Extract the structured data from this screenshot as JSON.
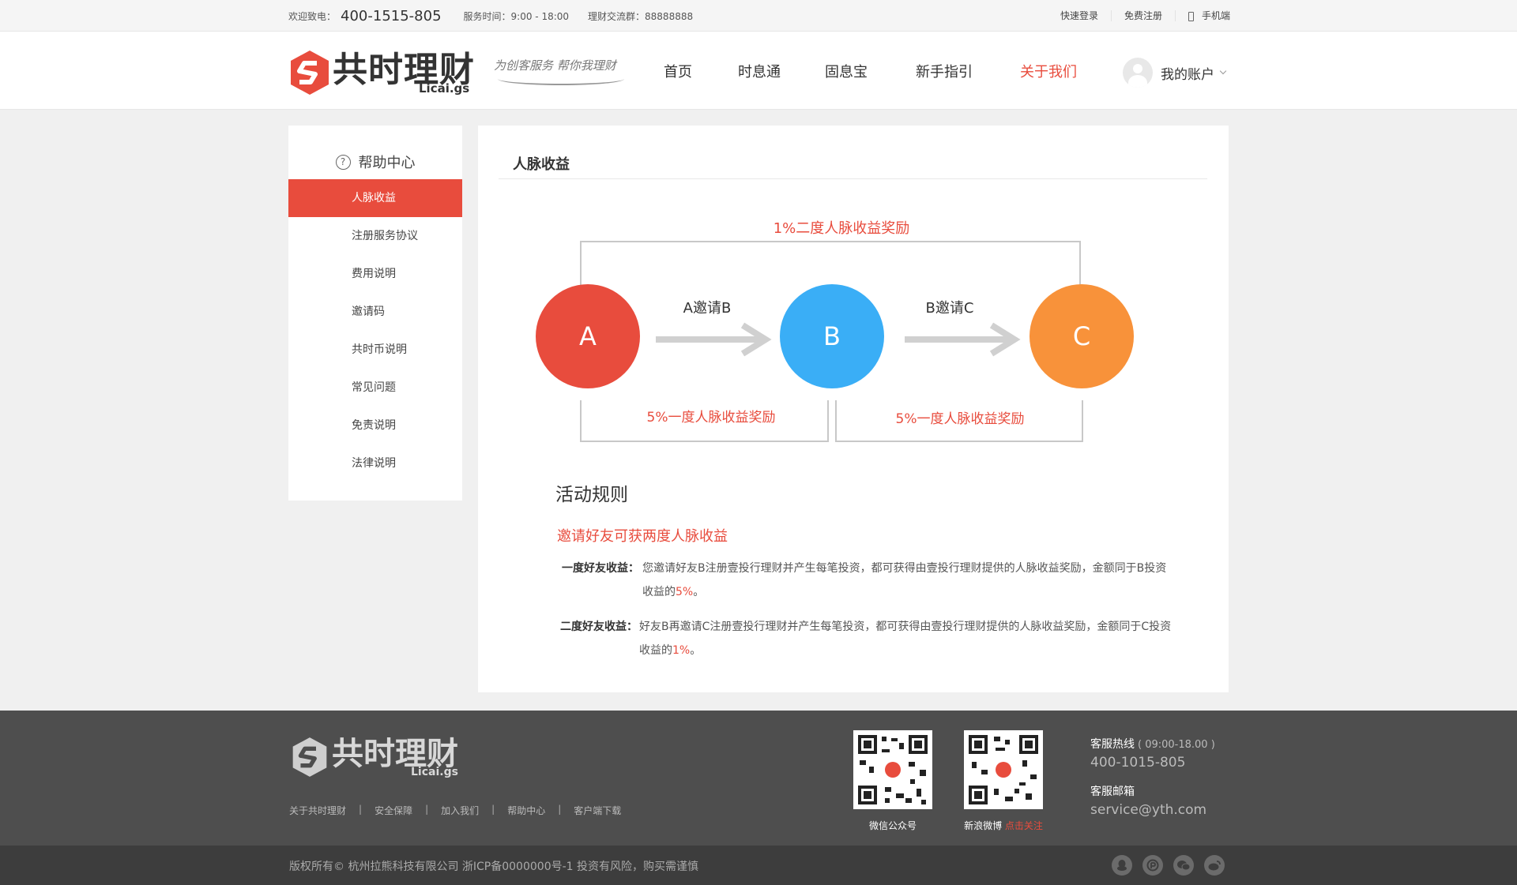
{
  "topbar": {
    "welcome": "欢迎致电：",
    "phone": "400-1515-805",
    "service_time": "服务时间：9:00 - 18:00",
    "group": "理财交流群：88888888",
    "links": [
      "快速登录",
      "免费注册",
      "手机端"
    ]
  },
  "header": {
    "logo_cn": "共时理财",
    "logo_en": "Licai.gs",
    "slogan": "为创客服务 帮你我理财",
    "nav": [
      "首页",
      "时息通",
      "固息宝",
      "新手指引",
      "关于我们"
    ],
    "active_nav": "关于我们",
    "account": "我的账户"
  },
  "sidebar": {
    "title": "帮助中心",
    "items": [
      "人脉收益",
      "注册服务协议",
      "费用说明",
      "邀请码",
      "共时币说明",
      "常见问题",
      "免责说明",
      "法律说明"
    ],
    "active": "人脉收益"
  },
  "content": {
    "title": "人脉收益",
    "diagram": {
      "top_label": "1%二度人脉收益奖励",
      "nodes": [
        {
          "label": "A",
          "color": "#e84c3d"
        },
        {
          "label": "B",
          "color": "#3aaef6"
        },
        {
          "label": "C",
          "color": "#f8923a"
        }
      ],
      "arrows": [
        "A邀请B",
        "B邀请C"
      ],
      "bottom_labels": [
        "5%一度人脉收益奖励",
        "5%一度人脉收益奖励"
      ]
    },
    "rules": {
      "heading": "活动规则",
      "subheading": "邀请好友可获两度人脉收益",
      "items": [
        {
          "label": "一度好友收益：",
          "text": "您邀请好友B注册壹投行理财并产生每笔投资，都可获得由壹投行理财提供的人脉收益奖励，金额同于B投资收益的",
          "pct": "5%",
          "end": "。"
        },
        {
          "label": "二度好友收益：",
          "text": "好友B再邀请C注册壹投行理财并产生每笔投资，都可获得由壹投行理财提供的人脉收益奖励，金额同于C投资收益的",
          "pct": "1%",
          "end": "。"
        }
      ]
    }
  },
  "footer": {
    "logo_cn": "共时理财",
    "logo_en": "Licai.gs",
    "links": [
      "关于共时理财",
      "安全保障",
      "加入我们",
      "帮助中心",
      "客户端下载"
    ],
    "qr_wechat": "微信公众号",
    "qr_weibo": "新浪微博",
    "qr_weibo_follow": "点击关注",
    "hotline_label": "客服热线",
    "hotline_time": "( 09:00-18.00 )",
    "hotline": "400-1015-805",
    "email_label": "客服邮箱",
    "email": "service@yth.com",
    "copyright": "版权所有© 杭州拉熊科技有限公司  浙ICP备0000000号-1  投资有风险，购买需谨慎"
  },
  "colors": {
    "accent": "#e84c3d",
    "node_b": "#3aaef6",
    "node_c": "#f8923a",
    "footer_bg": "#4e4e4e"
  }
}
